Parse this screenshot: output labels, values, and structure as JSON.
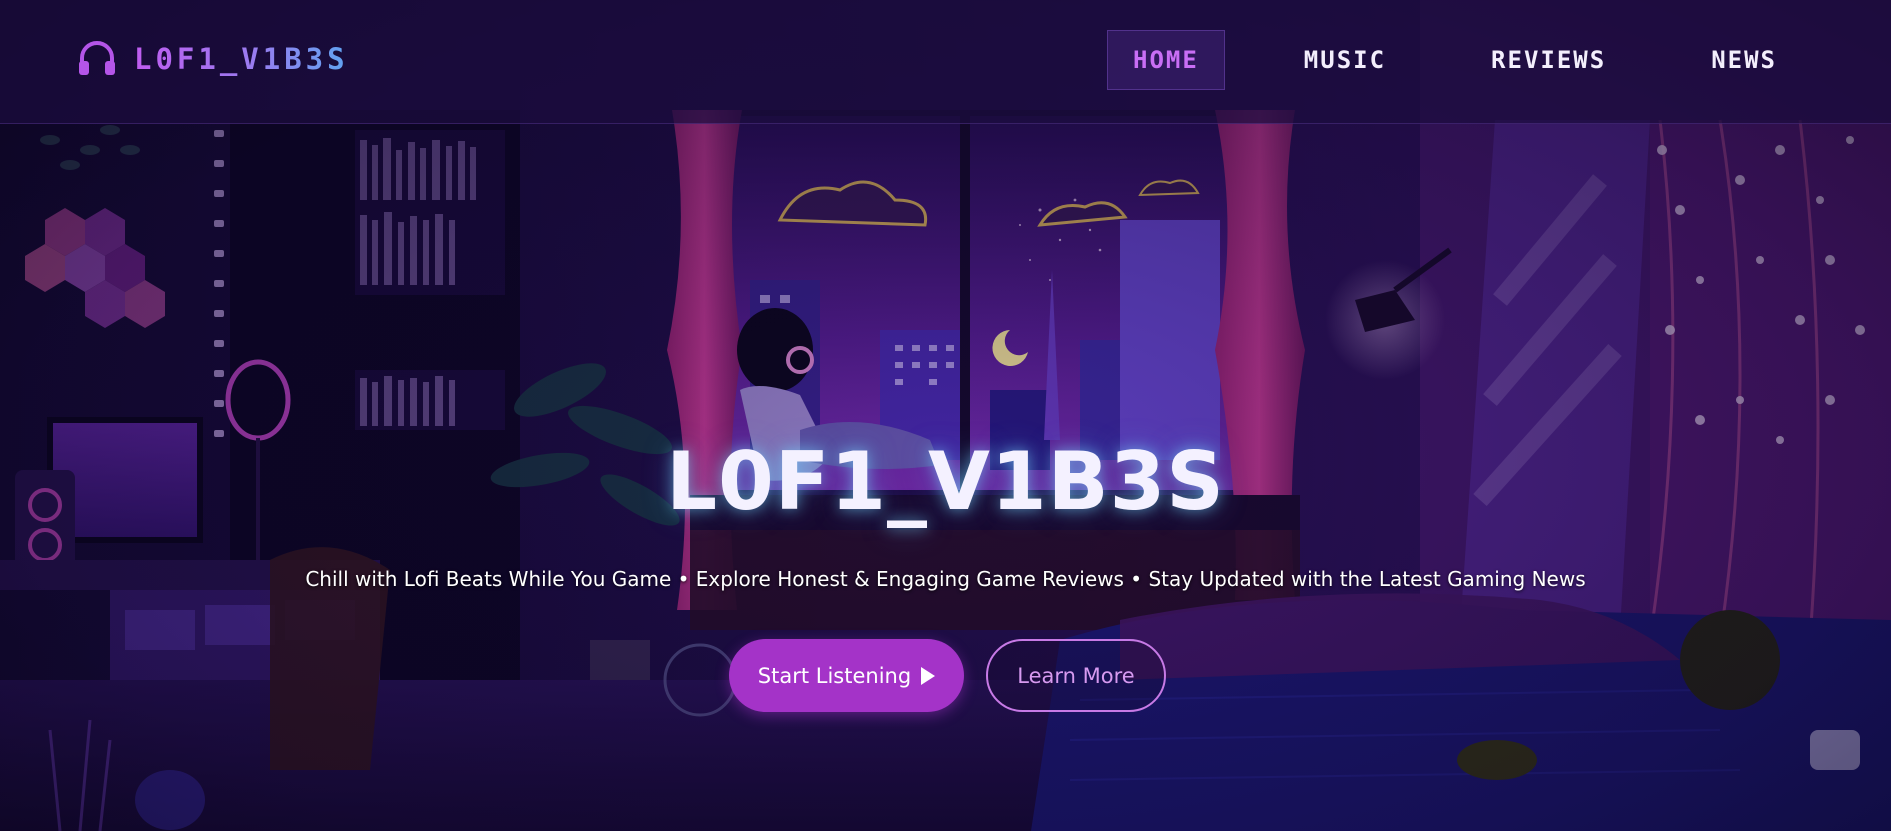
{
  "brand": {
    "name": "L0F1_V1B3S",
    "icon": "headphones-icon",
    "icon_color": "#b455e8"
  },
  "nav": {
    "items": [
      {
        "label": "HOME",
        "active": true
      },
      {
        "label": "MUSIC",
        "active": false
      },
      {
        "label": "REVIEWS",
        "active": false
      },
      {
        "label": "NEWS",
        "active": false
      }
    ],
    "active_color": "#c96ef5"
  },
  "hero": {
    "title": "L0F1_V1B3S",
    "tagline": "Chill with Lofi Beats While You Game • Explore Honest & Engaging Game Reviews • Stay Updated with the Latest Gaming News",
    "primary_button": {
      "label": "Start Listening",
      "icon": "play-icon"
    },
    "secondary_button": {
      "label": "Learn More"
    }
  },
  "colors": {
    "accent": "#a433c8",
    "background": "#12082e",
    "title_glow": "#78dcff"
  }
}
